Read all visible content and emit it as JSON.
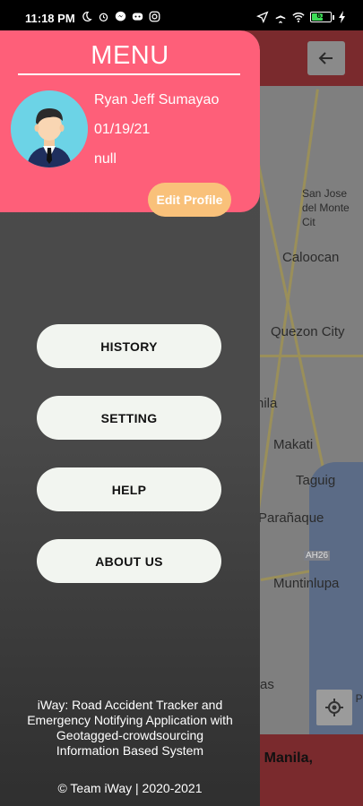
{
  "status_bar": {
    "time": "11:18 PM",
    "battery_level": "61",
    "battery_fraction": 0.61,
    "icons": [
      "moon-icon",
      "alarm-icon",
      "messenger-icon",
      "discord-icon",
      "instagram-icon",
      "location-arrow-icon",
      "airplane-icon",
      "wifi-icon",
      "battery-icon",
      "charging-icon"
    ]
  },
  "drawer": {
    "title": "MENU",
    "profile": {
      "name": "Ryan Jeff Sumayao",
      "date": "01/19/21",
      "extra": "null",
      "edit_label": "Edit Profile"
    },
    "menu_items": [
      {
        "label": "HISTORY"
      },
      {
        "label": "SETTING"
      },
      {
        "label": "HELP"
      },
      {
        "label": "ABOUT US"
      }
    ],
    "about": "iWay: Road Accident Tracker and Emergency Notifying Application with Geotagged-crowdsourcing Information Based System",
    "copyright": "© Team iWay | 2020-2021"
  },
  "map": {
    "places": [
      "San Jose del Monte Cit",
      "Caloocan",
      "Quezon City",
      "nila",
      "Makati",
      "Taguig",
      "Parañaque",
      "AH26",
      "Muntinlupa",
      "as",
      "San P"
    ],
    "bottom_card_text": "etro Manila,"
  },
  "colors": {
    "header_pink": "#fe5f79",
    "edit_button": "#f9c17a",
    "menu_button": "#f2f5f0",
    "drawer_dark": "#4a4a4a"
  }
}
